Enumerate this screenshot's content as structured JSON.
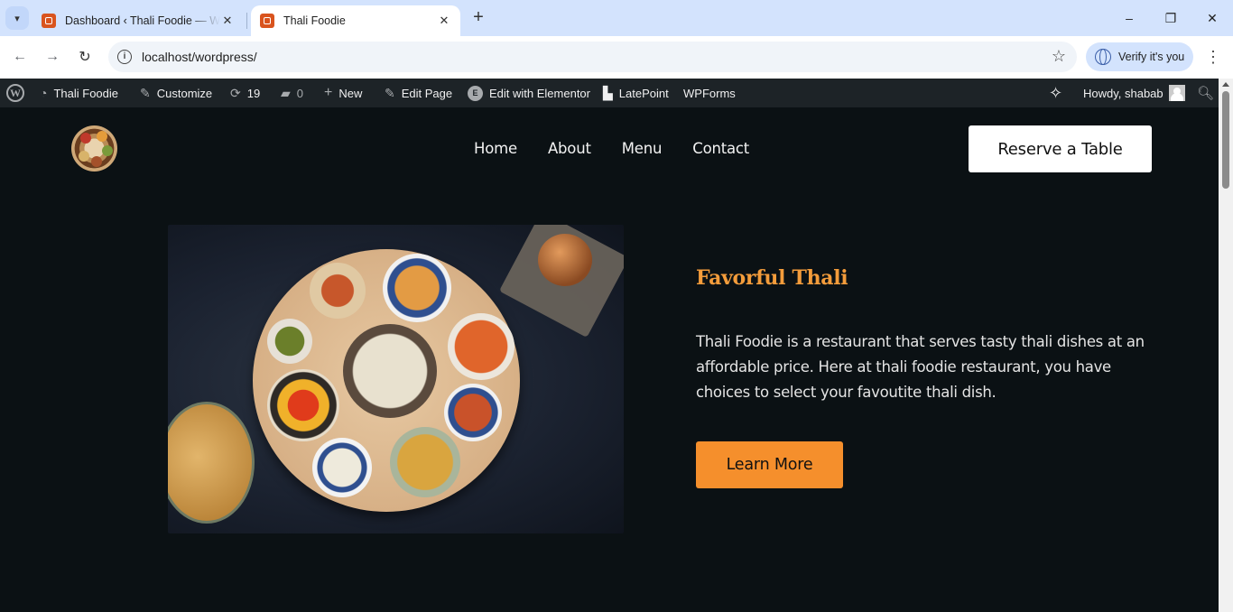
{
  "browser": {
    "tabs": [
      {
        "title": "Dashboard ‹ Thali Foodie — WordPress",
        "active": false
      },
      {
        "title": "Thali Foodie",
        "active": true
      }
    ],
    "new_tab": "+",
    "url": "localhost/wordpress/",
    "verify_label": "Verify it's you",
    "window_controls": {
      "minimize": "–",
      "restore": "❐",
      "close": "✕"
    }
  },
  "adminbar": {
    "site_name": "Thali Foodie",
    "customize": "Customize",
    "updates_count": "19",
    "comments_count": "0",
    "new": "New",
    "edit_page": "Edit Page",
    "edit_elementor": "Edit with Elementor",
    "latepoint": "LatePoint",
    "wpforms": "WPForms",
    "howdy": "Howdy, shabab"
  },
  "site": {
    "nav": [
      {
        "label": "Home"
      },
      {
        "label": "About"
      },
      {
        "label": "Menu"
      },
      {
        "label": "Contact"
      }
    ],
    "reserve_button": "Reserve a Table",
    "section_title": "Favorful Thali",
    "section_text": "Thali Foodie is a restaurant that serves tasty thali dishes at an affordable price. Here at thali foodie restaurant, you have choices to select your favoutite thali dish.",
    "learn_more": "Learn More"
  },
  "colors": {
    "page_bg": "#0b1114",
    "accent": "#f58f2c",
    "title_orange": "#f39c3b",
    "adminbar_bg": "#1d2327",
    "tabstrip_bg": "#d3e3fd"
  }
}
